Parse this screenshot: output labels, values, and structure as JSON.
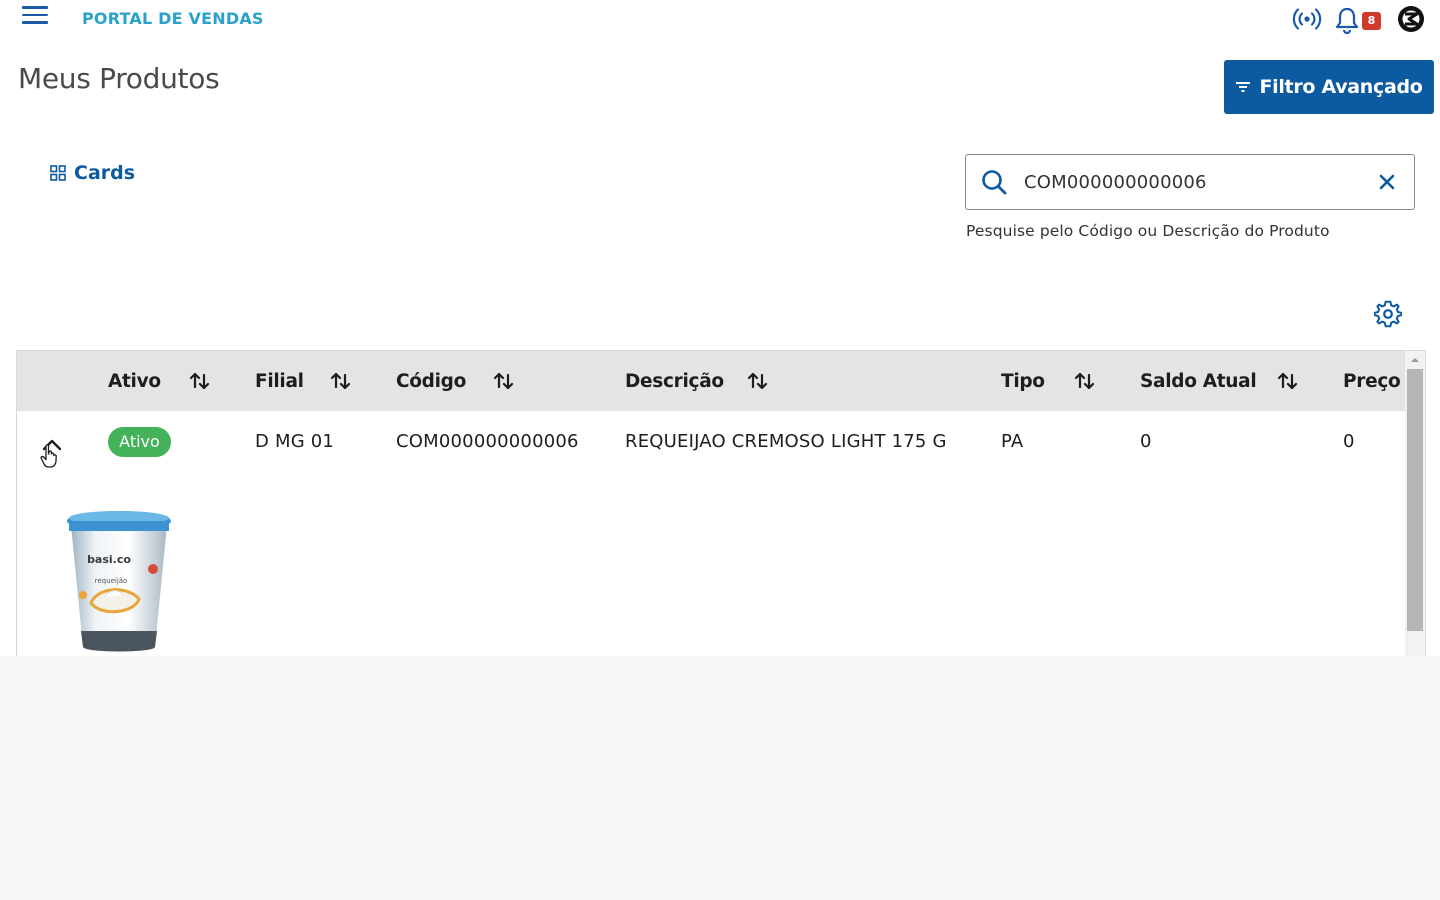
{
  "header": {
    "menu_icon": "hamburger-menu-icon",
    "portal_title": "PORTAL DE VENDAS",
    "notification_count": "8",
    "icons": [
      "broadcast-icon",
      "bell-icon",
      "company-logo-icon"
    ]
  },
  "page": {
    "title": "Meus Produtos",
    "filter_button": "Filtro Avançado",
    "view_toggle": "Cards"
  },
  "search": {
    "value": "COM000000000006",
    "help_text": "Pesquise pelo Código ou Descrição do Produto"
  },
  "table": {
    "columns": [
      "Ativo",
      "Filial",
      "Código",
      "Descrição",
      "Tipo",
      "Saldo Atual",
      "Preço U"
    ],
    "rows": [
      {
        "ativo": "Ativo",
        "filial": "D MG 01",
        "codigo": "COM000000000006",
        "descricao": "REQUEIJAO CREMOSO LIGHT 175 G",
        "tipo": "PA",
        "saldo_atual": "0",
        "preco": "0",
        "image_label": "basi.co",
        "image_sublabel": "requeijão"
      }
    ]
  },
  "colors": {
    "primary": "#0c5aa0",
    "portal_title": "#29a2c9",
    "status_active": "#43b25a",
    "badge": "#d13b2e",
    "table_header_bg": "#e4e4e4"
  }
}
